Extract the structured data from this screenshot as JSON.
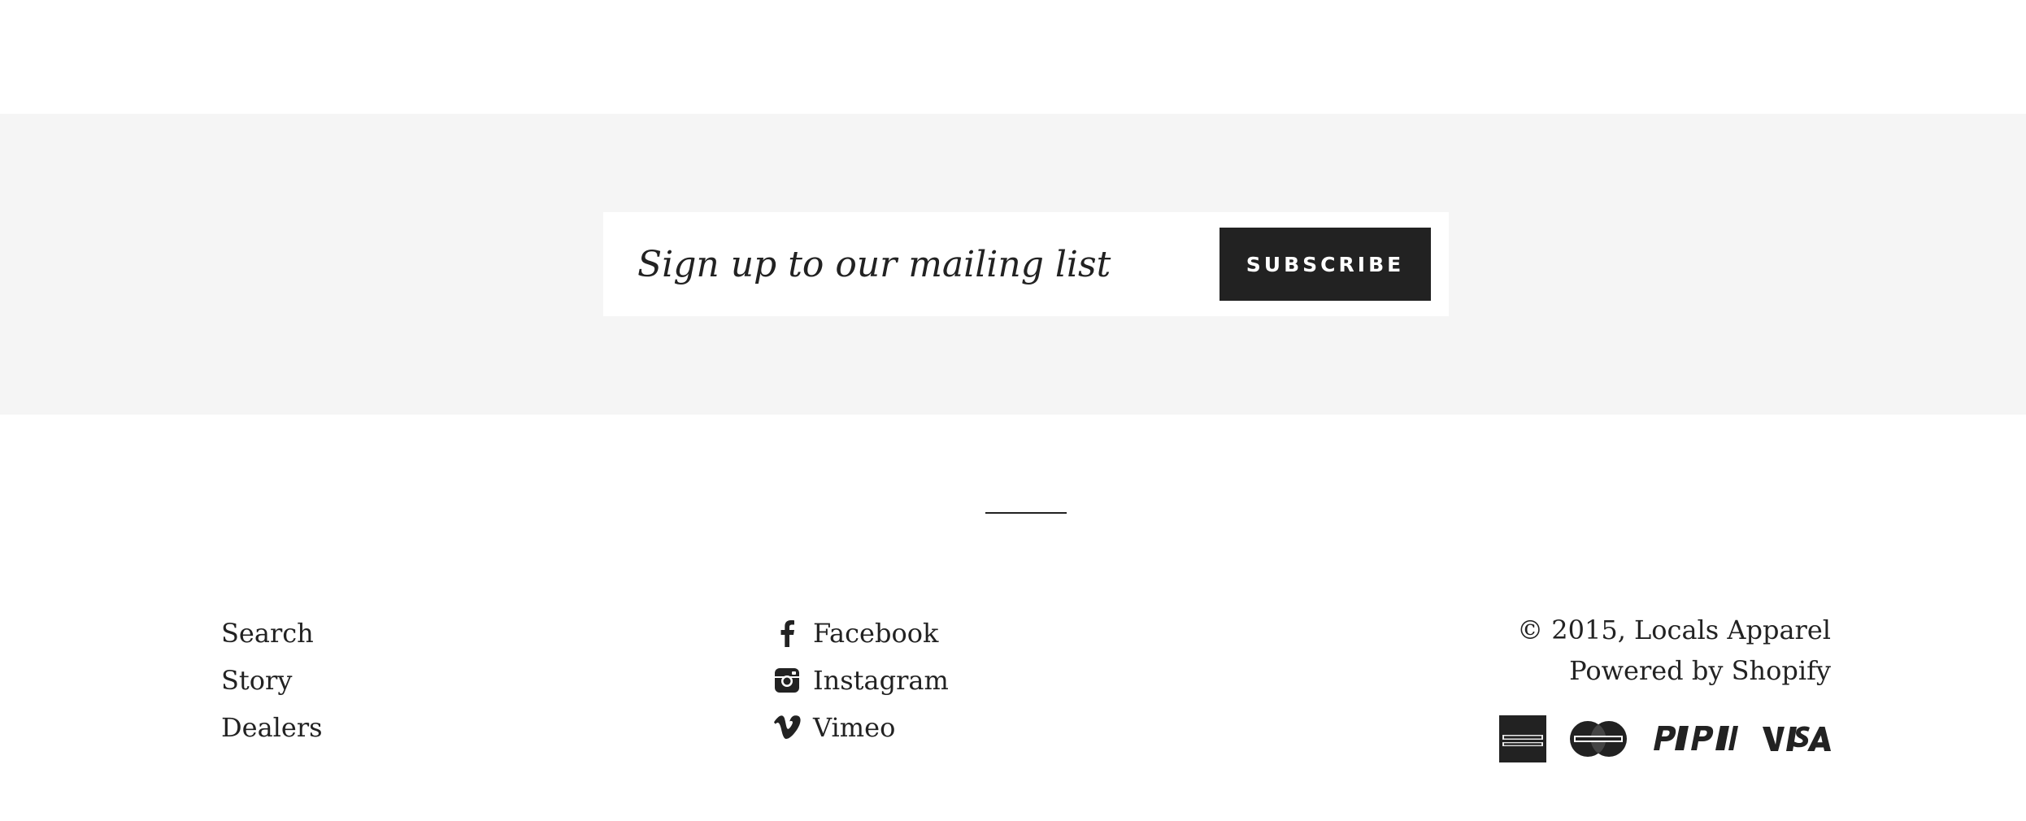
{
  "newsletter": {
    "placeholder": "Sign up to our mailing list",
    "subscribe_label": "SUBSCRIBE"
  },
  "footer": {
    "links": [
      {
        "label": "Search"
      },
      {
        "label": "Story"
      },
      {
        "label": "Dealers"
      }
    ],
    "social": [
      {
        "label": "Facebook",
        "icon": "facebook-icon"
      },
      {
        "label": "Instagram",
        "icon": "instagram-icon"
      },
      {
        "label": "Vimeo",
        "icon": "vimeo-icon"
      }
    ],
    "copyright": "© 2015, Locals Apparel",
    "powered_by": "Powered by Shopify",
    "payment_icons": [
      "american-express-icon",
      "mastercard-icon",
      "paypal-icon",
      "visa-icon"
    ]
  },
  "colors": {
    "band_background": "#f5f5f5",
    "button_background": "#222222",
    "text": "#222222"
  }
}
